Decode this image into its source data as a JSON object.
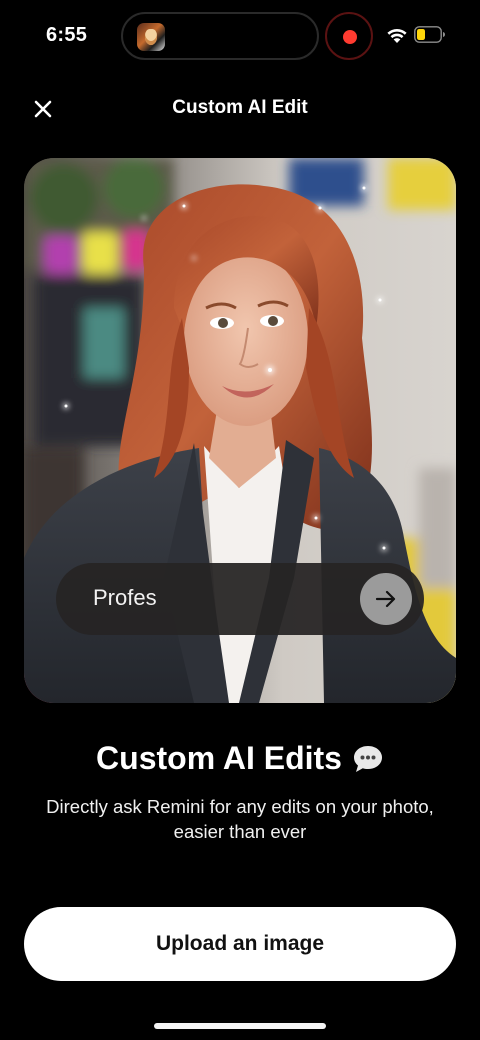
{
  "status_bar": {
    "time": "6:55",
    "icons": [
      "app-thumbnail-icon",
      "recording-icon",
      "wifi-icon",
      "battery-icon"
    ],
    "recording_color": "#ff3b30",
    "battery_color": "#ffd60a"
  },
  "header": {
    "close_icon": "close-icon",
    "title": "Custom AI Edit"
  },
  "hero": {
    "prompt_text": "Profes",
    "send_icon": "arrow-right-icon"
  },
  "content": {
    "headline": "Custom AI Edits",
    "headline_icon": "chat-bubble-icon",
    "subtitle_line1": "Directly ask Remini for any edits on your photo,",
    "subtitle_line2": "easier than ever"
  },
  "actions": {
    "upload_label": "Upload an image"
  }
}
